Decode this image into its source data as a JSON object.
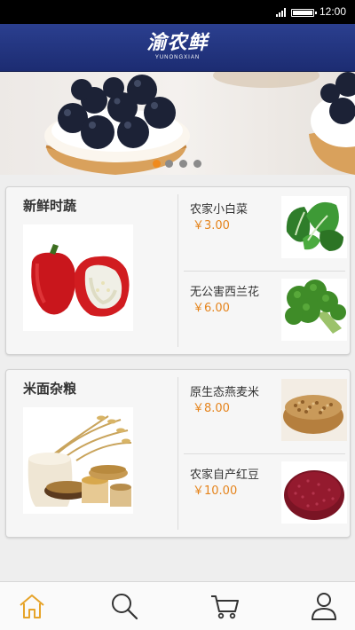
{
  "status_bar": {
    "time": "12:00"
  },
  "header": {
    "logo_text": "渝农鲜",
    "logo_sub": "YUNONGXIAN"
  },
  "banner": {
    "slides": 4,
    "active_slide": 1
  },
  "categories": [
    {
      "title": "新鲜时蔬",
      "products": [
        {
          "name": "农家小白菜",
          "price": "￥3.00"
        },
        {
          "name": "无公害西兰花",
          "price": "￥6.00"
        }
      ]
    },
    {
      "title": "米面杂粮",
      "products": [
        {
          "name": "原生态燕麦米",
          "price": "￥8.00"
        },
        {
          "name": "农家自产红豆",
          "price": "￥10.00"
        }
      ]
    }
  ],
  "tab_bar": {
    "items": [
      {
        "icon": "home-icon",
        "active": true
      },
      {
        "icon": "search-icon",
        "active": false
      },
      {
        "icon": "cart-icon",
        "active": false
      },
      {
        "icon": "user-icon",
        "active": false
      }
    ]
  },
  "colors": {
    "header": "#23378a",
    "price": "#e5841c",
    "active_tab": "#e6a42a",
    "active_dot": "#f08a1c"
  }
}
